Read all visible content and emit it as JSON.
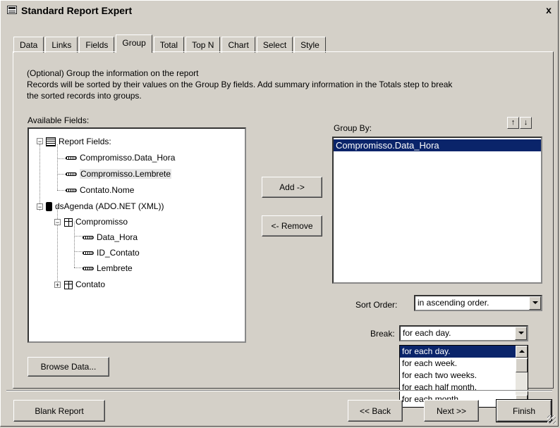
{
  "window": {
    "title": "Standard Report Expert",
    "close_label": "x"
  },
  "tabs": [
    "Data",
    "Links",
    "Fields",
    "Group",
    "Total",
    "Top N",
    "Chart",
    "Select",
    "Style"
  ],
  "active_tab": "Group",
  "description": {
    "line1": "(Optional)  Group the information on the report",
    "line2": "Records will be sorted by their values on the Group By fields.  Add summary information in the Totals step to break",
    "line3": "the sorted records into groups."
  },
  "available_fields": {
    "label": "Available Fields:",
    "tree": {
      "report_fields": "Report Fields:",
      "rf1": "Compromisso.Data_Hora",
      "rf2": "Compromisso.Lembrete",
      "rf3": "Contato.Nome",
      "dataset": "dsAgenda (ADO.NET (XML))",
      "table1": "Compromisso",
      "t1f1": "Data_Hora",
      "t1f2": "ID_Contato",
      "t1f3": "Lembrete",
      "table2": "Contato"
    }
  },
  "buttons": {
    "add": "Add ->",
    "remove": "<- Remove",
    "browse": "Browse Data...",
    "blank_report": "Blank Report",
    "back": "<< Back",
    "next": "Next >>",
    "finish": "Finish"
  },
  "group_by": {
    "label": "Group By:",
    "items": [
      "Compromisso.Data_Hora"
    ]
  },
  "sort_order": {
    "label": "Sort Order:",
    "value": "in ascending order."
  },
  "break": {
    "label": "Break:",
    "value": "for each day.",
    "options": [
      "for each day.",
      "for each week.",
      "for each two weeks.",
      "for each half month.",
      "for each month."
    ],
    "selected_index": 0
  },
  "colors": {
    "face": "#d4d0c8",
    "selection": "#0a246a"
  },
  "icons": [
    "form-icon",
    "close-icon",
    "move-up-icon",
    "move-down-icon",
    "report-fields-icon",
    "database-icon",
    "table-icon",
    "field-icon"
  ]
}
